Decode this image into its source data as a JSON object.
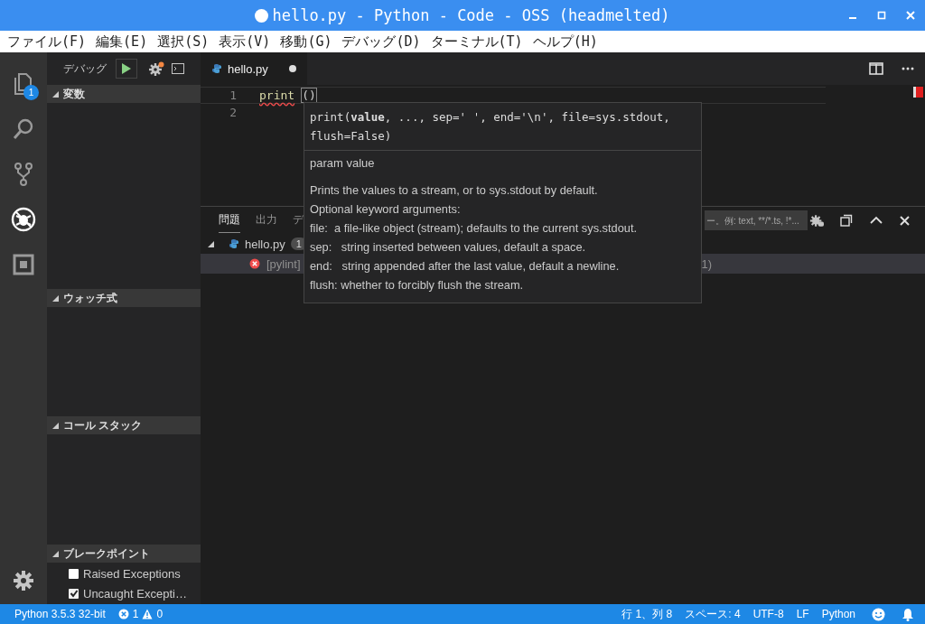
{
  "window": {
    "title": "hello.py - Python - Code - OSS (headmelted)",
    "modified": true
  },
  "menu": [
    "ファイル(F)",
    "編集(E)",
    "選択(S)",
    "表示(V)",
    "移動(G)",
    "デバッグ(D)",
    "ターミナル(T)",
    "ヘルプ(H)"
  ],
  "activity_bar": [
    {
      "kind": "files",
      "selected": false,
      "badge": "1"
    },
    {
      "kind": "search",
      "selected": false
    },
    {
      "kind": "scm",
      "selected": false
    },
    {
      "kind": "debug",
      "selected": true
    },
    {
      "kind": "extensions",
      "selected": false
    }
  ],
  "debug_toolbar": {
    "label": "デバッグ",
    "notification": true
  },
  "sidebar_sections": [
    {
      "title": "変数",
      "expanded": true
    },
    {
      "title": "ウォッチ式",
      "expanded": true
    },
    {
      "title": "コール スタック",
      "expanded": true
    },
    {
      "title": "ブレークポイント",
      "expanded": true,
      "items": [
        {
          "label": "Raised Exceptions",
          "checked": false
        },
        {
          "label": "Uncaught Excepti…",
          "checked": true
        }
      ]
    }
  ],
  "editor": {
    "tabs": [
      {
        "label": "hello.py",
        "selected": true,
        "dirty": true
      }
    ],
    "lines": [
      {
        "number": "1",
        "tokens": [
          {
            "text": "print",
            "kind": "function",
            "error": true
          },
          {
            "text": "()",
            "kind": "bracket"
          }
        ]
      },
      {
        "number": "2"
      }
    ]
  },
  "tooltip": {
    "signature": "print(**value**, ..., sep=' ', end='\\n', file=sys.stdout, flush=False)",
    "param": "param value",
    "doc": [
      "Prints the values to a stream, or to sys.stdout by default.",
      "Optional keyword arguments:",
      "file:  a file-like object (stream); defaults to the current sys.stdout.",
      "sep:   string inserted between values, default a space.",
      "end:   string appended after the last value, default a newline.",
      "flush: whether to forcibly flush the stream."
    ]
  },
  "panel": {
    "tabs": [
      {
        "label": "問題",
        "selected": true
      },
      {
        "label": "出力",
        "selected": false
      },
      {
        "label": "デ",
        "selected": false
      }
    ],
    "filter": {
      "placeholder": "ー。例: text, **/*.ts, !*..."
    },
    "problems": [
      {
        "file": "hello.py",
        "count": "1",
        "expanded": true,
        "items": [
          {
            "kind": "error",
            "source": "[pylint]",
            "tail": "1)",
            "selected": true
          }
        ]
      }
    ]
  },
  "status_bar": {
    "interpreter": "Python 3.5.3 32-bit",
    "errors": "1",
    "warnings": "0",
    "position": "行 1、列 8",
    "indent": "スペース: 4",
    "encoding": "UTF-8",
    "eol": "LF",
    "language": "Python"
  }
}
